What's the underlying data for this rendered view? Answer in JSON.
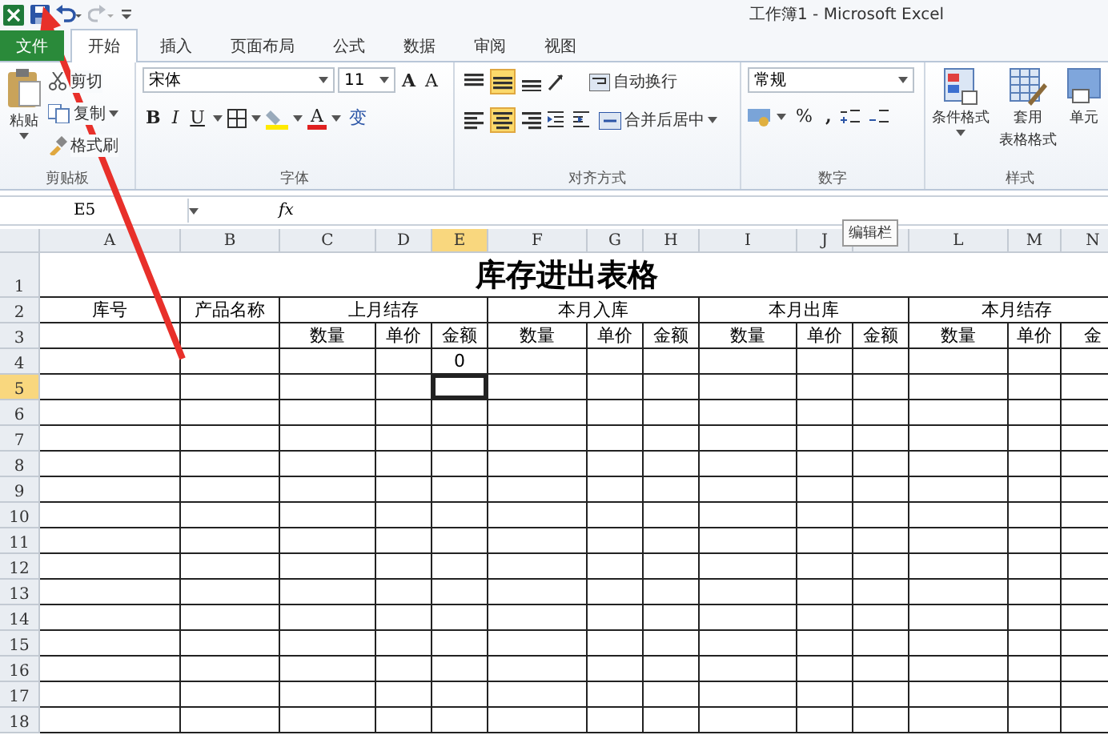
{
  "title_bar": {
    "title": "工作簿1 - Microsoft Excel"
  },
  "ribbon_tabs": [
    {
      "label": "文件",
      "kind": "file",
      "selected": false
    },
    {
      "label": "开始",
      "kind": "tab",
      "selected": true
    },
    {
      "label": "插入",
      "kind": "tab",
      "selected": false
    },
    {
      "label": "页面布局",
      "kind": "tab",
      "selected": false
    },
    {
      "label": "公式",
      "kind": "tab",
      "selected": false
    },
    {
      "label": "数据",
      "kind": "tab",
      "selected": false
    },
    {
      "label": "审阅",
      "kind": "tab",
      "selected": false
    },
    {
      "label": "视图",
      "kind": "tab",
      "selected": false
    }
  ],
  "clipboard": {
    "paste": "粘贴",
    "cut": "剪切",
    "copy": "复制",
    "format_painter": "格式刷",
    "group_label": "剪贴板"
  },
  "font": {
    "name": "宋体",
    "size": "11",
    "grow": "A",
    "shrink": "A",
    "bold": "B",
    "italic": "I",
    "underline": "U",
    "font_color": "A",
    "phonetic": "变",
    "group_label": "字体"
  },
  "alignment": {
    "vertical": [
      {
        "kind": "top",
        "selected": false
      },
      {
        "kind": "middle",
        "selected": true
      },
      {
        "kind": "bottom",
        "selected": false
      }
    ],
    "horizontal": [
      {
        "kind": "left",
        "selected": false
      },
      {
        "kind": "center",
        "selected": true
      },
      {
        "kind": "right",
        "selected": false
      }
    ],
    "wrap_text": "自动换行",
    "merge_center": "合并后居中",
    "group_label": "对齐方式"
  },
  "number": {
    "format": "常规",
    "percent": "%",
    "comma": ",",
    "group_label": "数字"
  },
  "styles": {
    "conditional": "条件格式",
    "table_format_1": "套用",
    "table_format_2": "表格格式",
    "cell_styles": "单元",
    "group_label": "样式"
  },
  "formula_bar": {
    "name_box": "E5",
    "fx": "fx"
  },
  "tooltip": "编辑栏",
  "sheet": {
    "columns": [
      {
        "label": "A",
        "selected": false
      },
      {
        "label": "B",
        "selected": false
      },
      {
        "label": "C",
        "selected": false
      },
      {
        "label": "D",
        "selected": false
      },
      {
        "label": "E",
        "selected": true
      },
      {
        "label": "F",
        "selected": false
      },
      {
        "label": "G",
        "selected": false
      },
      {
        "label": "H",
        "selected": false
      },
      {
        "label": "I",
        "selected": false
      },
      {
        "label": "J",
        "selected": false
      },
      {
        "selected": false
      },
      {
        "label": "L",
        "selected": false
      },
      {
        "label": "M",
        "selected": false
      },
      {
        "label": "N",
        "selected": false
      }
    ],
    "rows": [
      {
        "label": "1",
        "kind": "title",
        "selected": false,
        "text": "库存进出表格"
      },
      {
        "label": "2",
        "kind": "merged",
        "selected": false,
        "cells": [
          "库号",
          "产品名称",
          "上月结存",
          null,
          null,
          "本月入库",
          null,
          null,
          "本月出库",
          null,
          null,
          "本月结存",
          null,
          null
        ]
      },
      {
        "label": "3",
        "kind": "cells",
        "selected": false,
        "cells": [
          null,
          null,
          "数量",
          "单价",
          "金额",
          "数量",
          "单价",
          "金额",
          "数量",
          "单价",
          "金额",
          "数量",
          "单价",
          "金"
        ]
      },
      {
        "label": "4",
        "kind": "cells",
        "selected": false,
        "cells": [
          null,
          null,
          null,
          null,
          "0"
        ]
      },
      {
        "label": "5",
        "kind": "cells",
        "selected": true
      },
      {
        "label": "6",
        "kind": "cells",
        "selected": false
      },
      {
        "label": "7",
        "kind": "cells",
        "selected": false
      },
      {
        "label": "8",
        "kind": "cells",
        "selected": false
      },
      {
        "label": "9",
        "kind": "cells",
        "selected": false
      },
      {
        "label": "10",
        "kind": "cells",
        "selected": false
      },
      {
        "label": "11",
        "kind": "cells",
        "selected": false
      },
      {
        "label": "12",
        "kind": "cells",
        "selected": false
      },
      {
        "label": "13",
        "kind": "cells",
        "selected": false
      },
      {
        "label": "14",
        "kind": "cells",
        "selected": false
      },
      {
        "label": "15",
        "kind": "cells",
        "selected": false
      },
      {
        "label": "16",
        "kind": "cells",
        "selected": false
      },
      {
        "label": "17",
        "kind": "cells",
        "selected": false
      },
      {
        "label": "18",
        "kind": "cells",
        "selected": false
      }
    ]
  }
}
